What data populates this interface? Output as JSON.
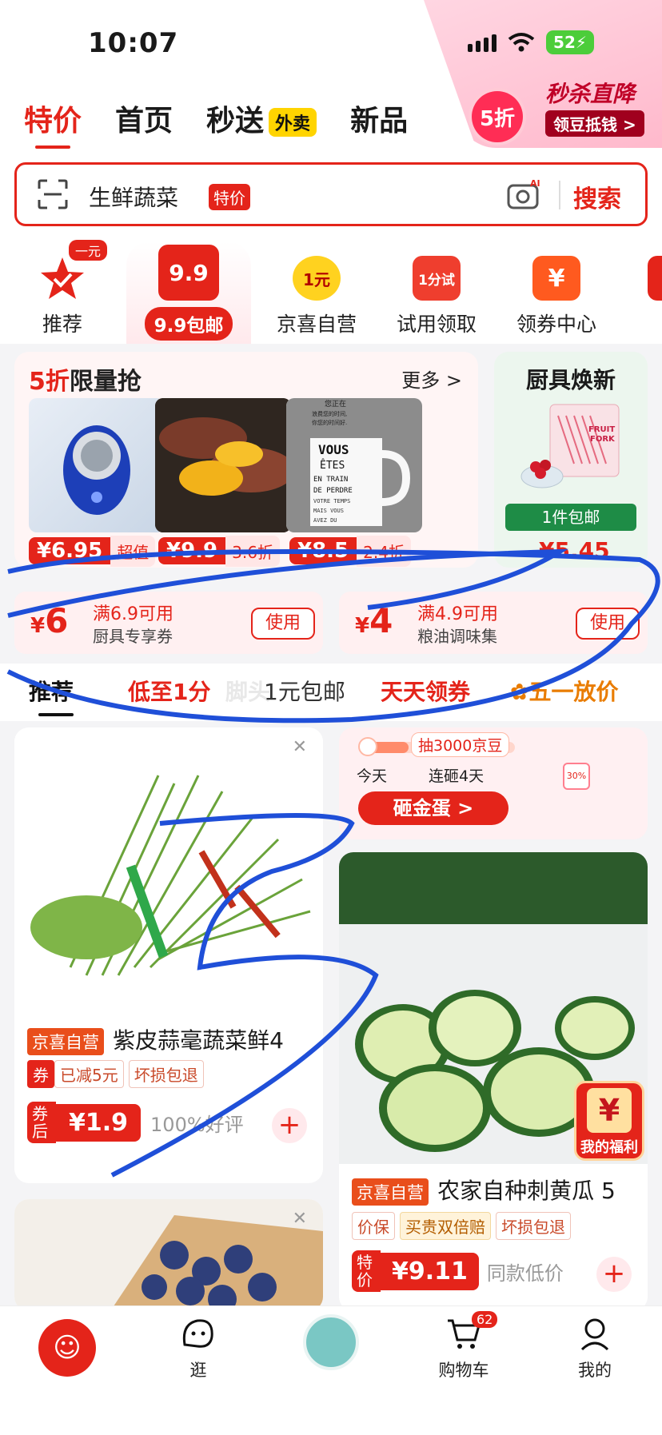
{
  "status_bar": {
    "time": "10:07",
    "battery": "52"
  },
  "promo": {
    "badge": "5折",
    "title": "秒杀直降",
    "subtitle": "领豆抵钱 >"
  },
  "nav": {
    "items": [
      "特价",
      "首页",
      "秒送",
      "新品"
    ],
    "waimai": "外卖"
  },
  "search": {
    "placeholder": "生鲜蔬菜",
    "tag": "特价",
    "button": "搜索",
    "ai_label": "AI"
  },
  "categories": [
    {
      "label": "推荐",
      "badge": "一元"
    },
    {
      "label": "9.9包邮",
      "icon_text": "9.9"
    },
    {
      "label": "京喜自营",
      "icon_text": "1元"
    },
    {
      "label": "试用领取",
      "icon_text": "1分试"
    },
    {
      "label": "领券中心",
      "icon_text": "¥"
    }
  ],
  "flash": {
    "title_highlight": "5折",
    "title_rest": "限量抢",
    "more": "更多 >",
    "products": [
      {
        "name": "shaver",
        "price": "¥6.95",
        "tag": "超值"
      },
      {
        "name": "sweet-potato",
        "price": "¥9.9",
        "tag": "3.6折"
      },
      {
        "name": "mug",
        "price": "¥8.5",
        "tag": "2.4折"
      }
    ],
    "mug_text": [
      "您正在",
      "浪费您的时间,",
      "你您的时间好.",
      "VOUS",
      "ÊTES",
      "EN TRAIN",
      "DE PERDRE",
      "VOTRE TEMPS",
      "MAIS VOUS",
      "AVEZ DU"
    ]
  },
  "kitchen": {
    "title": "厨具焕新",
    "ship": "1件包邮",
    "price": "¥5.45",
    "pack_text": [
      "FRUIT",
      "FORK"
    ]
  },
  "coupons": [
    {
      "amount": "6",
      "line1": "满6.9可用",
      "line2": "厨具专享券",
      "button": "使用"
    },
    {
      "amount": "4",
      "line1": "满4.9可用",
      "line2": "粮油调味集",
      "button": "使用"
    }
  ],
  "tabs": [
    "推荐",
    "低至1分",
    "脚头",
    "1元包邮",
    "天天领券",
    "五一放价"
  ],
  "feed": {
    "item1": {
      "self": "京喜自营",
      "title": "紫皮蒜毫蔬菜鲜4",
      "chips": [
        "券",
        "已减5元",
        "坏损包退"
      ],
      "price_label": "券后",
      "price": "¥1.9",
      "rating": "100%好评"
    },
    "egg": {
      "progress_label": "抽3000京豆",
      "today": "今天",
      "streak": "连砸4天",
      "button": "砸金蛋 >",
      "coupon_badge": "30%"
    },
    "item2": {
      "self": "京喜自营",
      "title": "农家自种刺黄瓜 5",
      "chips": [
        "价保",
        "买贵双倍赔",
        "坏损包退"
      ],
      "price_label": "特价",
      "price": "¥9.11",
      "note": "同款低价",
      "welfare": "我的福利",
      "welfare_icon": "¥"
    }
  },
  "bottom_nav": [
    {
      "label": ""
    },
    {
      "label": "逛"
    },
    {
      "label": ""
    },
    {
      "label": "购物车",
      "badge": "62"
    },
    {
      "label": "我的"
    }
  ]
}
